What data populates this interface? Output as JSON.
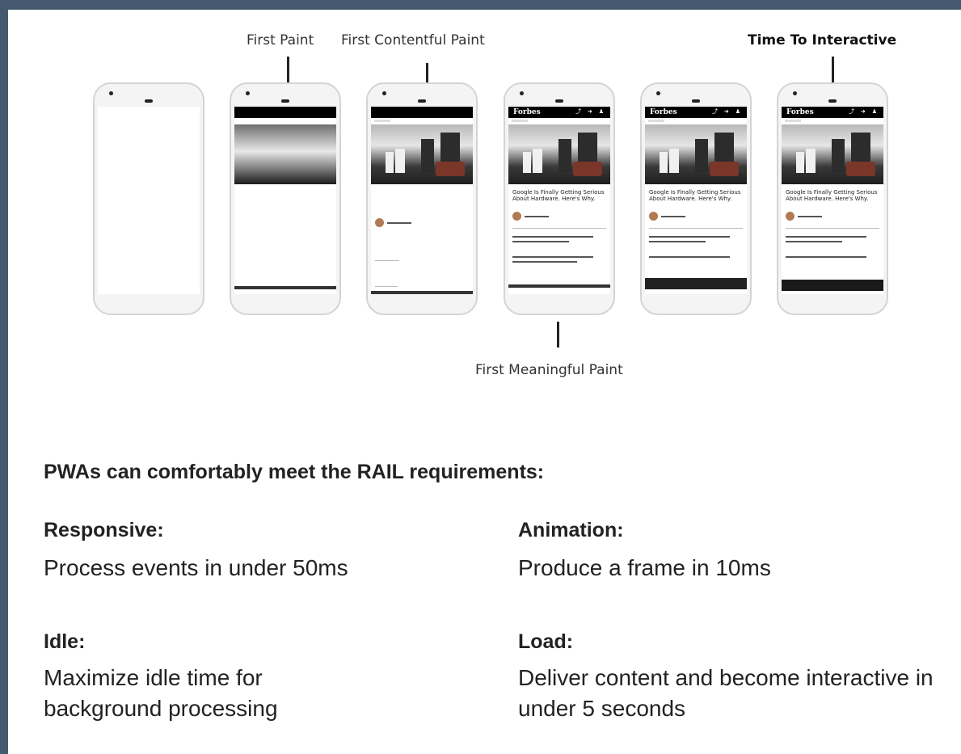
{
  "milestones": {
    "first_paint": "First Paint",
    "first_contentful_paint": "First Contentful Paint",
    "time_to_interactive": "Time To Interactive",
    "first_meaningful_paint": "First Meaningful Paint"
  },
  "phone_content": {
    "logo": "Forbes",
    "headline": "Google Is Finally Getting Serious About Hardware. Here's Why."
  },
  "rail": {
    "heading": "PWAs can comfortably meet the RAIL requirements:",
    "items": [
      {
        "term": "Responsive:",
        "desc": "Process events in under 50ms"
      },
      {
        "term": "Animation:",
        "desc": "Produce a frame in 10ms"
      },
      {
        "term": "Idle:",
        "desc": "Maximize idle time for background processing"
      },
      {
        "term": "Load:",
        "desc": "Deliver content and become interactive in under 5 seconds"
      }
    ]
  }
}
